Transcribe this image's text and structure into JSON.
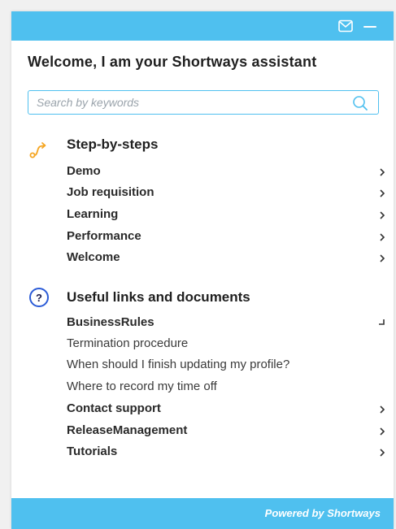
{
  "header": {
    "mail_icon": "mail-icon",
    "minimize_icon": "minimize-icon",
    "background_color": "#4fc0ef"
  },
  "welcome_text": "Welcome, I am your Shortways assistant",
  "search": {
    "placeholder": "Search by keywords",
    "value": "",
    "icon": "search-icon"
  },
  "step_by_steps": {
    "title": "Step-by-steps",
    "icon": "route-icon",
    "icon_color": "#f5a623",
    "items": [
      {
        "label": "Demo"
      },
      {
        "label": "Job requisition"
      },
      {
        "label": "Learning"
      },
      {
        "label": "Performance"
      },
      {
        "label": "Welcome"
      }
    ]
  },
  "useful_links": {
    "title": "Useful links and documents",
    "icon": "question-circle-icon",
    "icon_color": "#2b5bd7",
    "folder": {
      "label": "BusinessRules",
      "expanded": true,
      "children": [
        {
          "label": "Termination procedure"
        },
        {
          "label": "When should I finish updating my profile?"
        },
        {
          "label": "Where to record my time off"
        }
      ]
    },
    "items": [
      {
        "label": "Contact support"
      },
      {
        "label": "ReleaseManagement"
      },
      {
        "label": "Tutorials"
      }
    ]
  },
  "footer": {
    "text": "Powered by Shortways"
  }
}
